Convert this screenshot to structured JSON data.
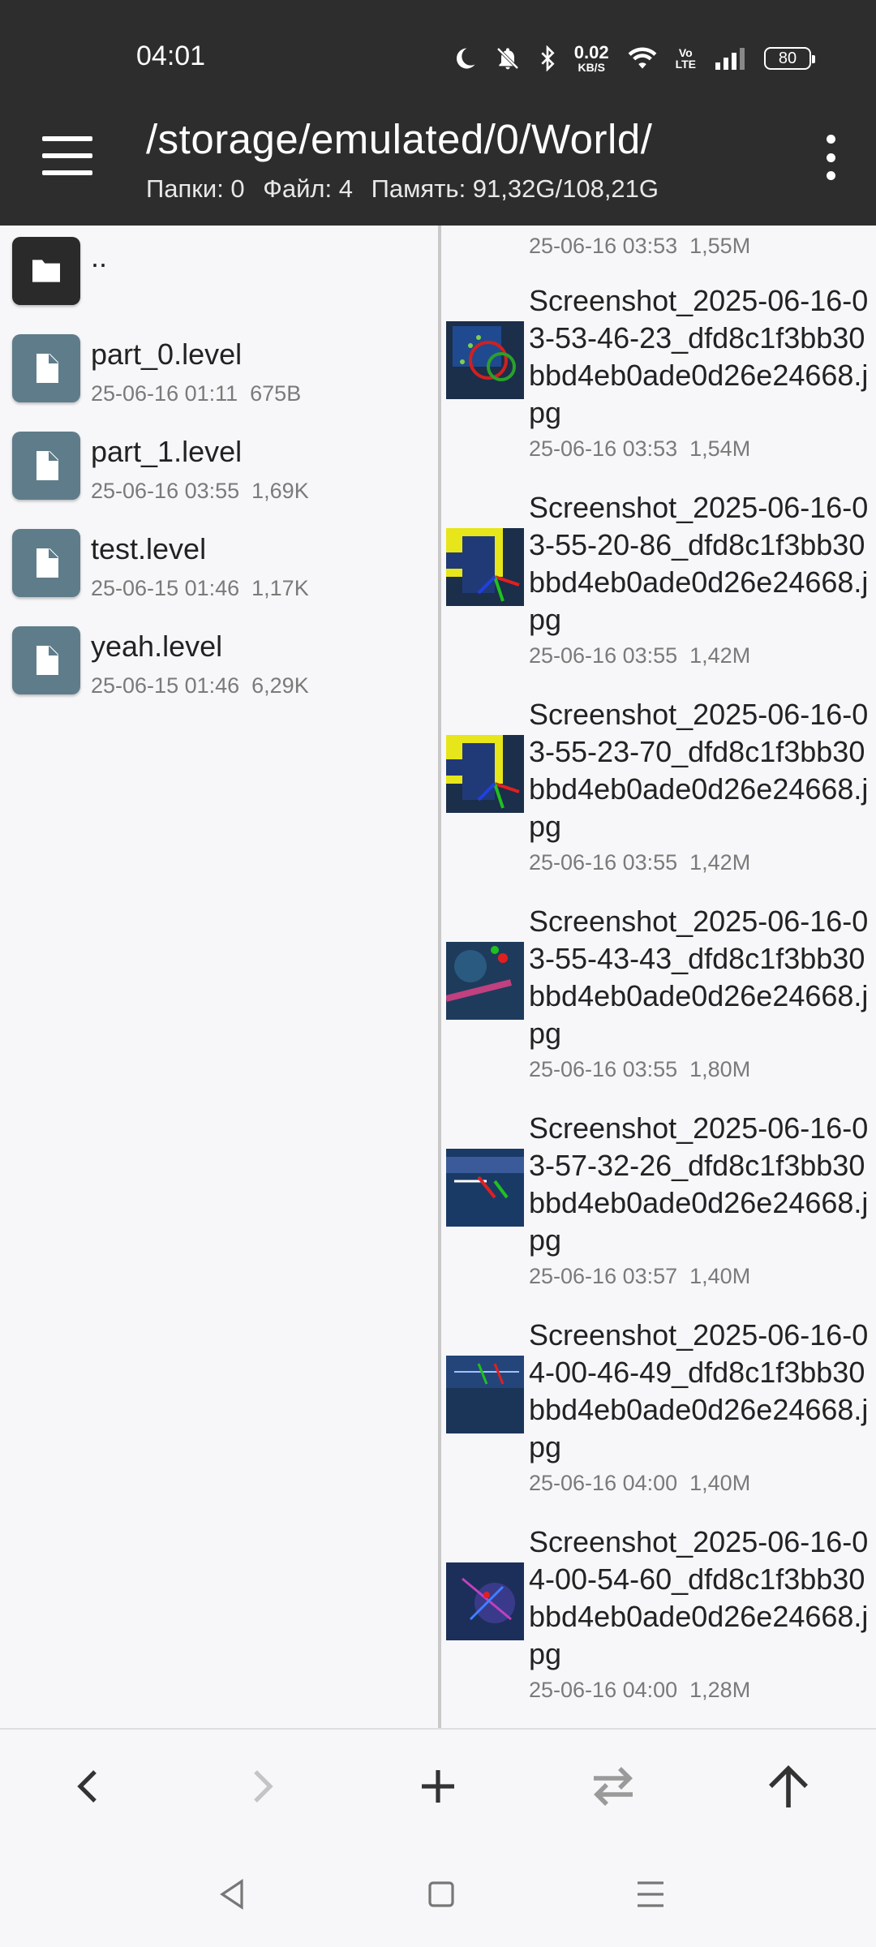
{
  "status_bar": {
    "time": "04:01",
    "speed_value": "0.02",
    "speed_unit": "KB/S",
    "volte_top": "Vo",
    "volte_bottom": "LTE",
    "battery": "80"
  },
  "toolbar": {
    "path": "/storage/emulated/0/World/",
    "folders": "Папки: 0",
    "files": "Файл: 4",
    "memory": "Память: 91,32G/108,21G"
  },
  "left_panel": {
    "items": [
      {
        "name": "..",
        "meta": "",
        "type": "folder"
      },
      {
        "name": "part_0.level",
        "meta": "25-06-16 01:11  675B",
        "type": "file"
      },
      {
        "name": "part_1.level",
        "meta": "25-06-16 03:55  1,69K",
        "type": "file"
      },
      {
        "name": "test.level",
        "meta": "25-06-15 01:46  1,17K",
        "type": "file"
      },
      {
        "name": "yeah.level",
        "meta": "25-06-15 01:46  6,29K",
        "type": "file"
      }
    ]
  },
  "right_panel": {
    "partial_meta": "25-06-16 03:53  1,55M",
    "items": [
      {
        "name": "Screenshot_2025-06-16-03-53-46-23_dfd8c1f3bb30bbd4eb0ade0d26e24668.jpg",
        "meta": "25-06-16 03:53  1,54M"
      },
      {
        "name": "Screenshot_2025-06-16-03-55-20-86_dfd8c1f3bb30bbd4eb0ade0d26e24668.jpg",
        "meta": "25-06-16 03:55  1,42M"
      },
      {
        "name": "Screenshot_2025-06-16-03-55-23-70_dfd8c1f3bb30bbd4eb0ade0d26e24668.jpg",
        "meta": "25-06-16 03:55  1,42M"
      },
      {
        "name": "Screenshot_2025-06-16-03-55-43-43_dfd8c1f3bb30bbd4eb0ade0d26e24668.jpg",
        "meta": "25-06-16 03:55  1,80M"
      },
      {
        "name": "Screenshot_2025-06-16-03-57-32-26_dfd8c1f3bb30bbd4eb0ade0d26e24668.jpg",
        "meta": "25-06-16 03:57  1,40M"
      },
      {
        "name": "Screenshot_2025-06-16-04-00-46-49_dfd8c1f3bb30bbd4eb0ade0d26e24668.jpg",
        "meta": "25-06-16 04:00  1,40M"
      },
      {
        "name": "Screenshot_2025-06-16-04-00-54-60_dfd8c1f3bb30bbd4eb0ade0d26e24668.jpg",
        "meta": "25-06-16 04:00  1,28M"
      }
    ]
  },
  "action_bar": {
    "icons": [
      "back-arrow-icon",
      "forward-arrow-icon",
      "add-icon",
      "swap-icon",
      "up-arrow-icon"
    ]
  },
  "nav_bar": {
    "icons": [
      "nav-back-icon",
      "nav-home-icon",
      "nav-recents-icon"
    ]
  },
  "colors": {
    "toolbar_bg": "#2d2d2d",
    "file_icon_bg": "#5f7c8a",
    "folder_icon_bg": "#2a2a2a",
    "background": "#f7f7f9"
  }
}
